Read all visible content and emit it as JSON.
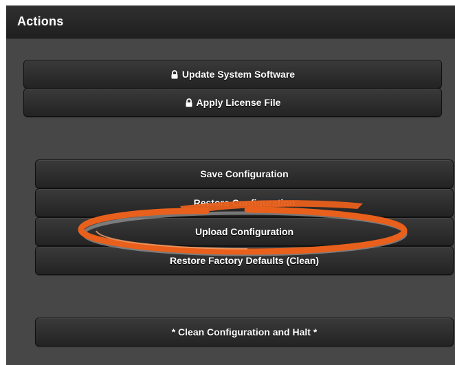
{
  "panel": {
    "title": "Actions"
  },
  "buttons": {
    "update_software": "Update System Software",
    "apply_license": "Apply License File",
    "save_config": "Save Configuration",
    "restore_config": "Restore Configuration",
    "upload_config": "Upload Configuration",
    "restore_factory": "Restore Factory Defaults (Clean)",
    "clean_halt": "* Clean Configuration and Halt *"
  },
  "icons": {
    "lock": "lock-icon",
    "highlight": "highlight-ellipse"
  },
  "colors": {
    "annotation": "#e8601c",
    "panel_bg": "#474747",
    "header_bg": "#262626",
    "button_bg": "#2d2d2d"
  }
}
